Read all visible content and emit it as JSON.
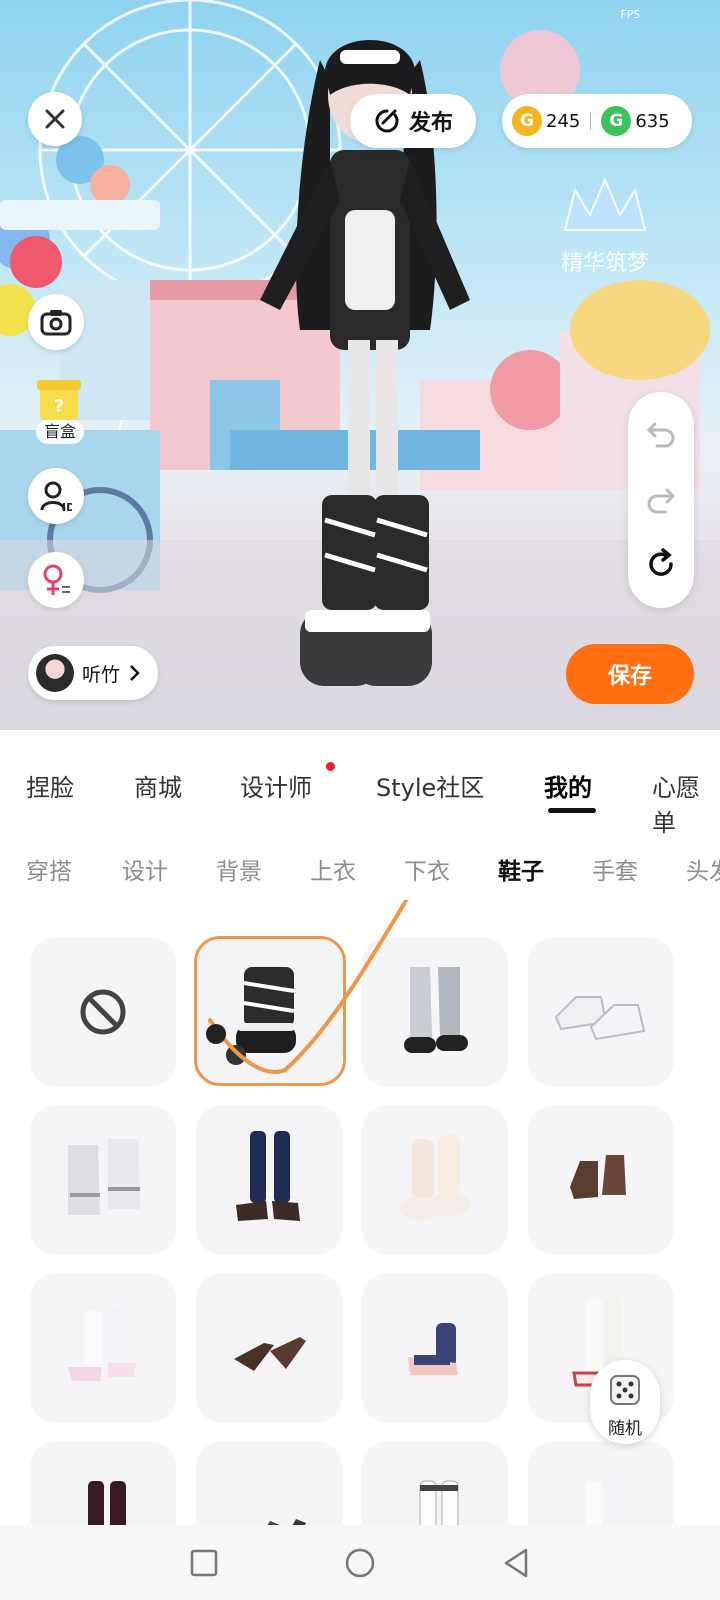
{
  "status": {
    "fps_label": "FPS"
  },
  "scene": {
    "publish_label": "发布",
    "currency": {
      "gold": "245",
      "green": "635"
    },
    "blind_box_label": "盲盒",
    "user_name": "听竹",
    "save_label": "保存",
    "logo_text": "精华筑梦"
  },
  "main_tabs": [
    {
      "label": "捏脸"
    },
    {
      "label": "商城"
    },
    {
      "label": "设计师"
    },
    {
      "label": "Style社区"
    },
    {
      "label": "我的",
      "active": true
    },
    {
      "label": "心愿单"
    }
  ],
  "sub_tabs": [
    {
      "label": "穿搭"
    },
    {
      "label": "设计"
    },
    {
      "label": "背景"
    },
    {
      "label": "上衣"
    },
    {
      "label": "下衣"
    },
    {
      "label": "鞋子",
      "active": true
    },
    {
      "label": "手套"
    },
    {
      "label": "头发"
    }
  ],
  "grid": {
    "items": [
      {
        "kind": "none-icon"
      },
      {
        "kind": "black-striped-boots",
        "selected": true
      },
      {
        "kind": "grey-fur-boots"
      },
      {
        "kind": "white-sneakers"
      },
      {
        "kind": "white-leg-warmers"
      },
      {
        "kind": "navy-socks-loafers"
      },
      {
        "kind": "cream-knit-slippers"
      },
      {
        "kind": "brown-boots"
      },
      {
        "kind": "white-socks-pink-shoes"
      },
      {
        "kind": "brown-pumps"
      },
      {
        "kind": "navy-socks-sandals"
      },
      {
        "kind": "white-knee-boots"
      },
      {
        "kind": "maroon-socks"
      },
      {
        "kind": "black-heels"
      },
      {
        "kind": "white-striped-socks"
      },
      {
        "kind": "white-tall-socks"
      }
    ]
  },
  "random_label": "随机",
  "colors": {
    "accent": "#ff6f12",
    "badge": "#e8202a",
    "highlight": "#f0964a"
  }
}
